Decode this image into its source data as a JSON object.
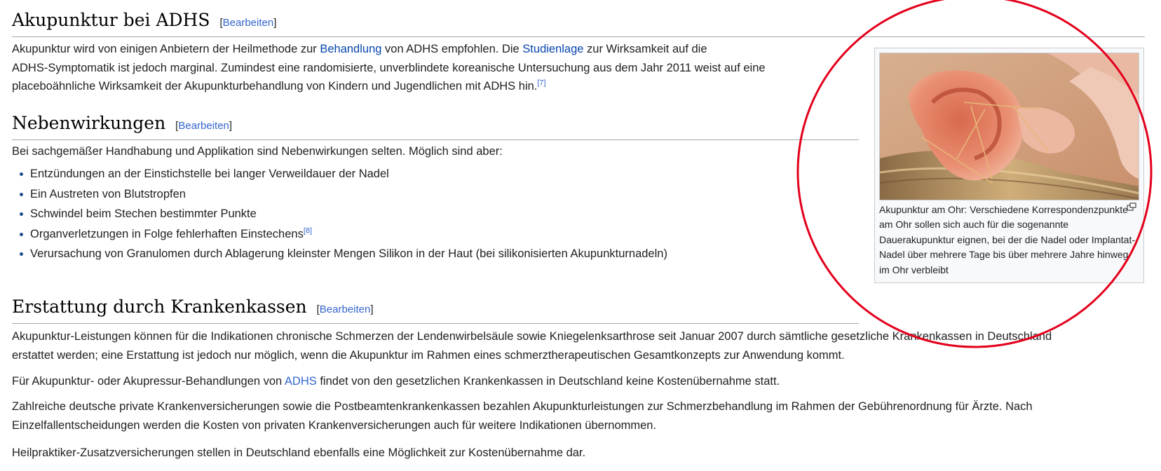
{
  "sections": [
    {
      "heading": "Akupunktur bei ADHS",
      "edit_label": "Bearbeiten",
      "paragraph": {
        "line1_pre": "Akupunktur wird von einigen Anbietern der Heilmethode zur ",
        "line1_link1": "Behandlung",
        "line1_mid": " von ADHS empfohlen. Die ",
        "line1_link2": "Studienlage",
        "line1_post": " zur Wirksamkeit auf die",
        "line2": "ADHS-Symptomatik ist jedoch marginal. Zumindest eine randomisierte, unverblindete koreanische Untersuchung aus dem Jahr 2011 weist auf eine",
        "line3": "placeboähnliche Wirksamkeit der Akupunkturbehandlung von Kindern und Jugendlichen mit ADHS hin.",
        "ref": "[7]"
      }
    },
    {
      "heading": "Nebenwirkungen",
      "edit_label": "Bearbeiten",
      "intro": "Bei sachgemäßer Handhabung und Applikation sind Nebenwirkungen selten. Möglich sind aber:",
      "items": [
        {
          "text": "Entzündungen an der Einstichstelle bei langer Verweildauer der Nadel",
          "ref": ""
        },
        {
          "text": "Ein Austreten von Blutstropfen",
          "ref": ""
        },
        {
          "text": "Schwindel beim Stechen bestimmter Punkte",
          "ref": ""
        },
        {
          "text": "Organverletzungen in Folge fehlerhaften Einstechens",
          "ref": "[8]"
        },
        {
          "text": "Verursachung von Granulomen durch Ablagerung kleinster Mengen Silikon in der Haut (bei silikonisierten Akupunkturnadeln)",
          "ref": ""
        }
      ]
    },
    {
      "heading": "Erstattung durch Krankenkassen",
      "edit_label": "Bearbeiten",
      "p1_line1": "Akupunktur-Leistungen können für die Indikationen chronische Schmerzen der Lendenwirbelsäule sowie Kniegelenksarthrose seit Januar 2007 durch sämtliche gesetzliche Krankenkassen in Deutschland",
      "p1_line2": "erstattet werden; eine Erstattung ist jedoch nur möglich, wenn die Akupunktur im Rahmen eines schmerztherapeutischen Gesamtkonzepts zur Anwendung kommt.",
      "p2_pre": "Für Akupunktur- oder Akupressur-Behandlungen von ",
      "p2_link": "ADHS",
      "p2_post": " findet von den gesetzlichen Krankenkassen in Deutschland keine Kostenübernahme statt.",
      "p3_line1": "Zahlreiche deutsche private Krankenversicherungen sowie die Postbeamtenkrankenkassen bezahlen Akupunkturleistungen zur Schmerzbehandlung im Rahmen der Gebührenordnung für Ärzte. Nach",
      "p3_line2": "Einzelfallentscheidungen werden die Kosten von privaten Krankenversicherungen auch für weitere Indikationen übernommen.",
      "p4": "Heilpraktiker-Zusatzversicherungen stellen in Deutschland ebenfalls eine Möglichkeit zur Kostenübernahme dar."
    }
  ],
  "thumbnail": {
    "caption": "Akupunktur am Ohr: Verschiedene Korrespondenzpunkte am Ohr sollen sich auch für die sogenannte Dauerakupunktur eignen, bei der die Nadel oder Implantat-Nadel über mehrere Tage bis über mehrere Jahre hinweg im Ohr verbleibt",
    "magnify_icon": "magnify-clip-icon"
  },
  "annotation": {
    "shape": "circle",
    "color": "#e3001b"
  },
  "colors": {
    "link": "#3366cc",
    "visited_link": "#0645ad",
    "text": "#202122",
    "rule": "#a2a9b1"
  }
}
